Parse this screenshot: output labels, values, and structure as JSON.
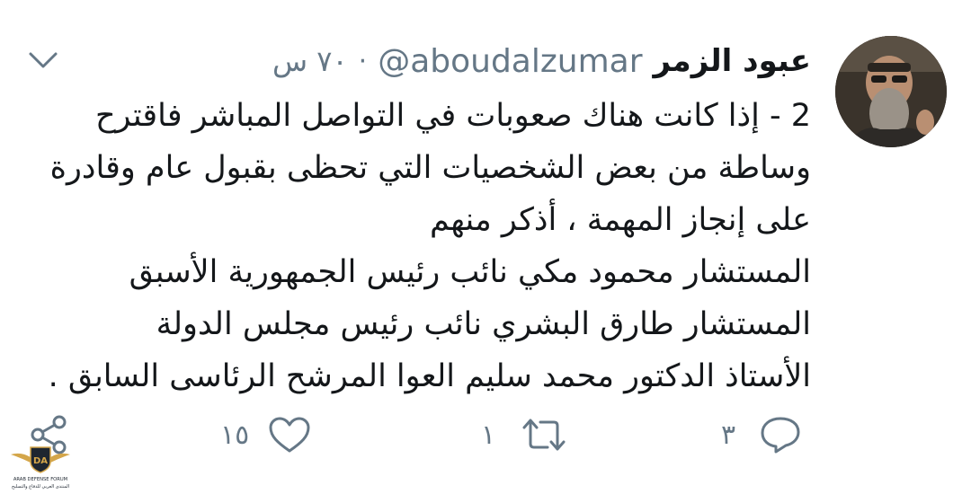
{
  "tweet": {
    "display_name": "عبود الزمر",
    "handle": "@aboudalzumar",
    "separator": "·",
    "time": "٧٠ س",
    "lines": [
      "2 - إذا كانت هناك صعوبات في التواصل المباشر فاقترح",
      "وساطة من بعض الشخصيات التي تحظى بقبول عام وقادرة",
      "على إنجاز المهمة ، أذكر منهم",
      "المستشار محمود مكي نائب رئيس الجمهورية الأسبق",
      "المستشار  طارق البشري نائب رئيس مجلس الدولة",
      "الأستاذ الدكتور محمد سليم العوا المرشح الرئاسى السابق ."
    ]
  },
  "actions": {
    "reply_count": "٣",
    "retweet_count": "١",
    "like_count": "١٥"
  },
  "watermark": {
    "badge_text": "DA",
    "line1": "ARAB DEFENSE FORUM",
    "line2": "المنتدى العربي للدفاع والتسليح"
  },
  "colors": {
    "text": "#14171a",
    "secondary": "#657786",
    "background": "#ffffff"
  }
}
